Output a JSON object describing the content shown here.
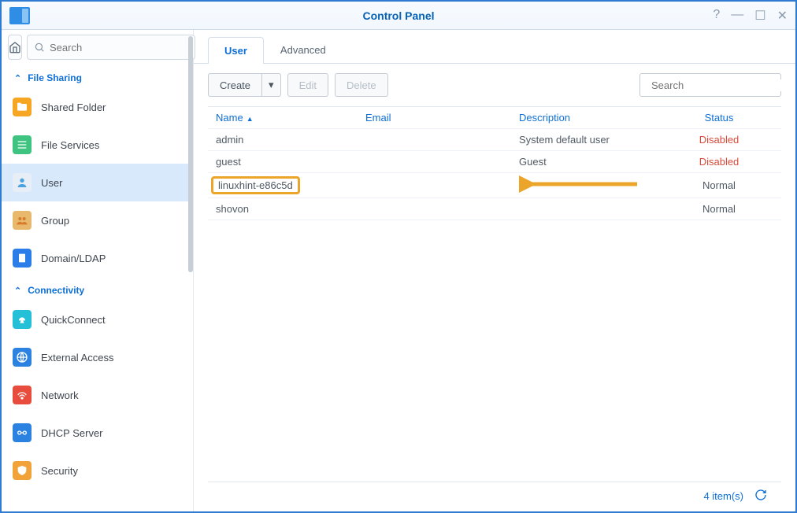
{
  "window": {
    "title": "Control Panel",
    "search_placeholder": "Search"
  },
  "sidebar": {
    "sections": {
      "file_sharing": "File Sharing",
      "connectivity": "Connectivity"
    },
    "items": {
      "shared_folder": "Shared Folder",
      "file_services": "File Services",
      "user": "User",
      "group": "Group",
      "domain_ldap": "Domain/LDAP",
      "quickconnect": "QuickConnect",
      "external_access": "External Access",
      "network": "Network",
      "dhcp_server": "DHCP Server",
      "security": "Security"
    }
  },
  "tabs": {
    "user": "User",
    "advanced": "Advanced"
  },
  "toolbar": {
    "create": "Create",
    "edit": "Edit",
    "delete": "Delete",
    "search_placeholder": "Search"
  },
  "grid": {
    "headers": {
      "name": "Name",
      "email": "Email",
      "description": "Description",
      "status": "Status"
    },
    "rows": [
      {
        "name": "admin",
        "email": "",
        "description": "System default user",
        "status": "Disabled",
        "status_class": "disabled"
      },
      {
        "name": "guest",
        "email": "",
        "description": "Guest",
        "status": "Disabled",
        "status_class": "disabled"
      },
      {
        "name": "linuxhint-e86c5d",
        "email": "",
        "description": "",
        "status": "Normal",
        "status_class": "normal",
        "highlighted": true
      },
      {
        "name": "shovon",
        "email": "",
        "description": "",
        "status": "Normal",
        "status_class": "normal"
      }
    ],
    "footer": {
      "count_label": "4 item(s)"
    }
  }
}
